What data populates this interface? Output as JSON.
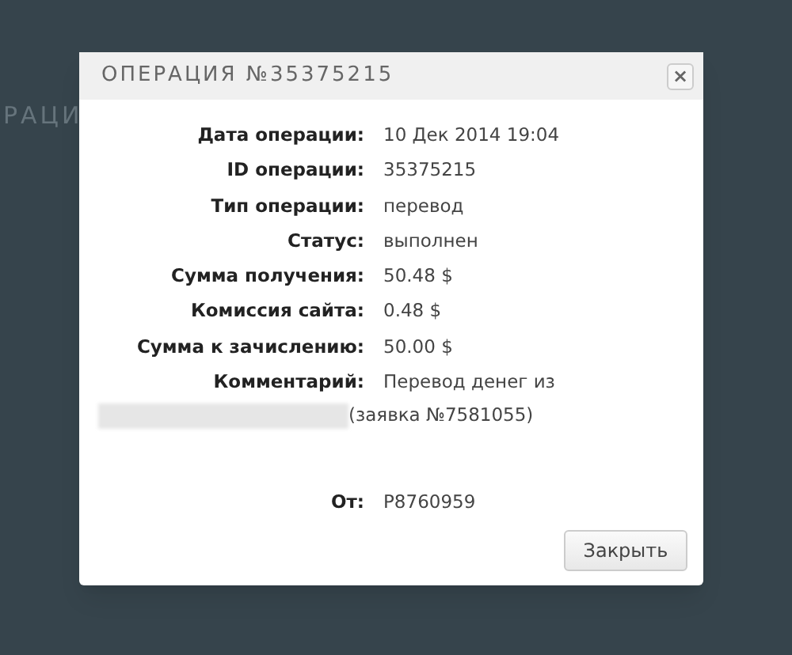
{
  "background": {
    "heading": "РАЦИ"
  },
  "dialog": {
    "title": "ОПЕРАЦИЯ №35375215",
    "close_icon": "×",
    "fields": [
      {
        "label": "Дата операции:",
        "value": "10 Дек 2014 19:04"
      },
      {
        "label": "ID операции:",
        "value": "35375215"
      },
      {
        "label": "Тип операции:",
        "value": "перевод"
      },
      {
        "label": "Статус:",
        "value": "выполнен"
      },
      {
        "label": "Сумма получения:",
        "value": "50.48 $"
      },
      {
        "label": "Комиссия сайта:",
        "value": "0.48 $"
      },
      {
        "label": "Сумма к зачислению:",
        "value": "50.00 $"
      },
      {
        "label": "Комментарий:",
        "value": "Перевод денег из"
      }
    ],
    "comment_continuation": "(заявка №7581055)",
    "from": {
      "label": "От:",
      "value": "P8760959"
    },
    "button": "Закрыть"
  }
}
